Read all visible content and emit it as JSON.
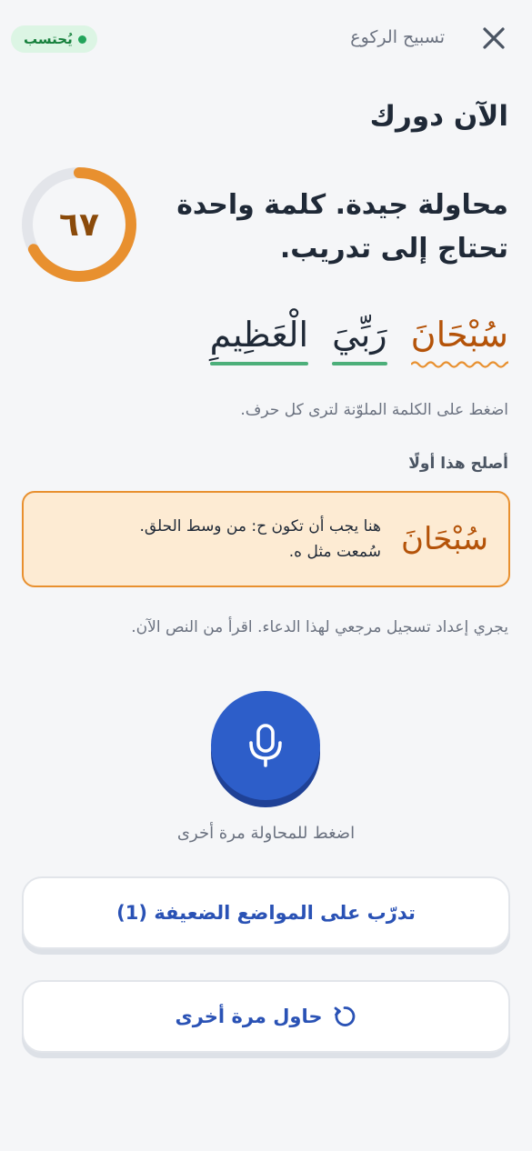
{
  "header": {
    "title": "تسبيح الركوع",
    "close_icon": "close-icon",
    "badge": "يُحتسب",
    "badge_color": "#22a45a"
  },
  "heading": "الآن دورك",
  "score": {
    "value": "٦٧",
    "fraction": 0.67,
    "color": "#e8902f",
    "track_color": "#e3e5ea"
  },
  "feedback": "محاولة جيدة. كلمة واحدة تحتاج إلى تدريب.",
  "words": [
    {
      "text": "سُبْحَانَ",
      "status": "needs-work",
      "color": "#b45309"
    },
    {
      "text": "رَبِّيَ",
      "status": "correct",
      "color": "#4caf7a"
    },
    {
      "text": "الْعَظِيمِ",
      "status": "correct",
      "color": "#4caf7a"
    }
  ],
  "tap_hint": "اضغط على الكلمة الملوّنة لترى كل حرف.",
  "fix_first": {
    "label": "أصلح هذا أولًا",
    "word": "سُبْحَانَ",
    "line1": "هنا يجب أن تكون ح: من وسط الحلق.",
    "line2": "سُمعت مثل ه."
  },
  "reference_note": "يجري إعداد تسجيل مرجعي لهذا الدعاء. اقرأ من النص الآن.",
  "mic": {
    "icon": "microphone-icon",
    "caption": "اضغط للمحاولة مرة أخرى"
  },
  "buttons": {
    "practice": "تدرّب على المواضع الضعيفة (1)",
    "retry": "حاول مرة أخرى",
    "retry_icon": "retry-icon"
  }
}
